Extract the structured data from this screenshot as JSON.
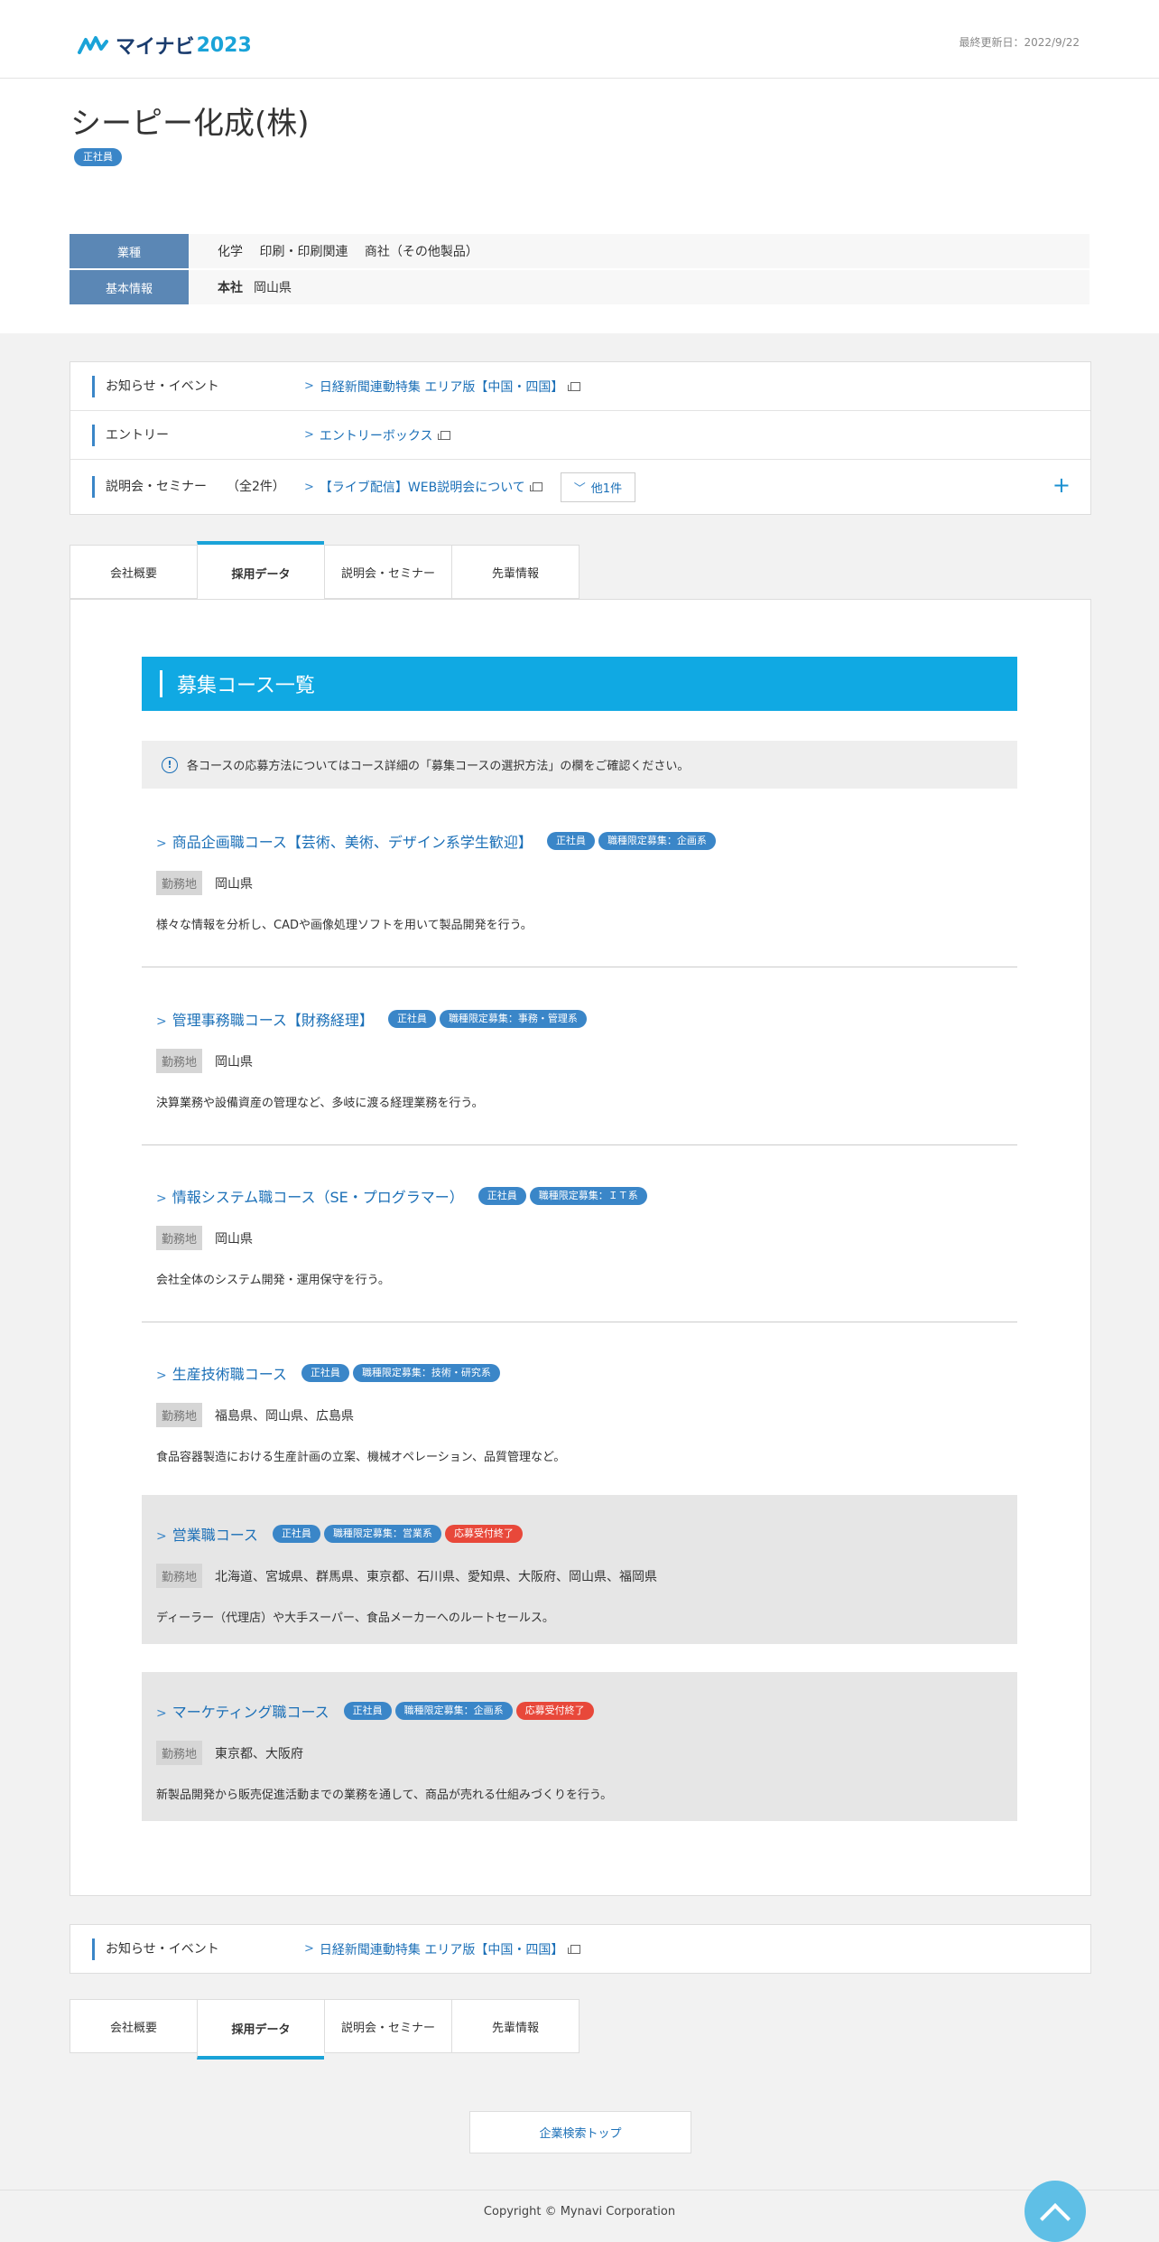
{
  "header": {
    "logo_text": "マイナビ",
    "logo_year": "2023",
    "updated": "最終更新日：2022/9/22"
  },
  "company": {
    "name": "シーピー化成(株)",
    "badge": "正社員",
    "info": [
      {
        "label": "業種",
        "value": "化学　 印刷・印刷関連　 商社（その他製品）",
        "prefix": ""
      },
      {
        "label": "基本情報",
        "value": "岡山県",
        "prefix": "本社"
      }
    ]
  },
  "links": {
    "news_label": "お知らせ・イベント",
    "news_link": "日経新聞連動特集 エリア版【中国・四国】",
    "entry_label": "エントリー",
    "entry_link": "エントリーボックス",
    "seminar_label": "説明会・セミナー",
    "seminar_count": "（全2件）",
    "seminar_link": "【ライブ配信】WEB説明会について",
    "seminar_more": "他1件"
  },
  "tabs": [
    "会社概要",
    "採用データ",
    "説明会・セミナー",
    "先輩情報"
  ],
  "section_title": "募集コース一覧",
  "notice": "各コースの応募方法についてはコース詳細の「募集コースの選択方法」の欄をご確認ください。",
  "loc_label": "勤務地",
  "courses": [
    {
      "title": "商品企画職コース【芸術、美術、デザイン系学生歓迎】",
      "badges": [
        "正社員",
        "職種限定募集：企画系"
      ],
      "closed": "",
      "location": "岡山県",
      "desc": "様々な情報を分析し、CADや画像処理ソフトを用いて製品開発を行う。"
    },
    {
      "title": "管理事務職コース【財務経理】",
      "badges": [
        "正社員",
        "職種限定募集：事務・管理系"
      ],
      "closed": "",
      "location": "岡山県",
      "desc": "決算業務や設備資産の管理など、多岐に渡る経理業務を行う。"
    },
    {
      "title": "情報システム職コース（SE・プログラマー）",
      "badges": [
        "正社員",
        "職種限定募集：ＩＴ系"
      ],
      "closed": "",
      "location": "岡山県",
      "desc": "会社全体のシステム開発・運用保守を行う。"
    },
    {
      "title": "生産技術職コース",
      "badges": [
        "正社員",
        "職種限定募集：技術・研究系"
      ],
      "closed": "",
      "location": "福島県、岡山県、広島県",
      "desc": "食品容器製造における生産計画の立案、機械オペレーション、品質管理など。"
    },
    {
      "title": "営業職コース",
      "badges": [
        "正社員",
        "職種限定募集：営業系"
      ],
      "closed": "応募受付終了",
      "location": "北海道、宮城県、群馬県、東京都、石川県、愛知県、大阪府、岡山県、福岡県",
      "desc": "ディーラー（代理店）や大手スーパー、食品メーカーへのルートセールス。"
    },
    {
      "title": "マーケティング職コース",
      "badges": [
        "正社員",
        "職種限定募集：企画系"
      ],
      "closed": "応募受付終了",
      "location": "東京都、大阪府",
      "desc": "新製品開発から販売促進活動までの業務を通して、商品が売れる仕組みづくりを行う。"
    }
  ],
  "bottom": {
    "top_button": "企業検索トップ",
    "copyright": "Copyright © Mynavi Corporation"
  },
  "colors": {
    "accent": "#10a9e3",
    "badge": "#3a86c8",
    "closed": "#e8483a",
    "link": "#1a6fb7"
  }
}
